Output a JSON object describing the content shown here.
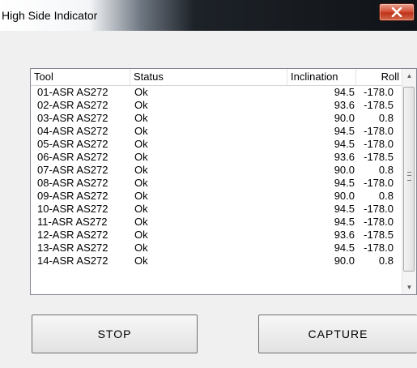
{
  "window": {
    "title": "High Side Indicator"
  },
  "list": {
    "columns": {
      "tool": "Tool",
      "status": "Status",
      "inclination": "Inclination",
      "roll": "Roll"
    },
    "rows": [
      {
        "tool": "01-ASR AS272",
        "status": "Ok",
        "inclination": "94.5",
        "roll": "-178.0"
      },
      {
        "tool": "02-ASR AS272",
        "status": "Ok",
        "inclination": "93.6",
        "roll": "-178.5"
      },
      {
        "tool": "03-ASR AS272",
        "status": "Ok",
        "inclination": "90.0",
        "roll": "0.8"
      },
      {
        "tool": "04-ASR AS272",
        "status": "Ok",
        "inclination": "94.5",
        "roll": "-178.0"
      },
      {
        "tool": "05-ASR AS272",
        "status": "Ok",
        "inclination": "94.5",
        "roll": "-178.0"
      },
      {
        "tool": "06-ASR AS272",
        "status": "Ok",
        "inclination": "93.6",
        "roll": "-178.5"
      },
      {
        "tool": "07-ASR AS272",
        "status": "Ok",
        "inclination": "90.0",
        "roll": "0.8"
      },
      {
        "tool": "08-ASR AS272",
        "status": "Ok",
        "inclination": "94.5",
        "roll": "-178.0"
      },
      {
        "tool": "09-ASR AS272",
        "status": "Ok",
        "inclination": "90.0",
        "roll": "0.8"
      },
      {
        "tool": "10-ASR AS272",
        "status": "Ok",
        "inclination": "94.5",
        "roll": "-178.0"
      },
      {
        "tool": "11-ASR AS272",
        "status": "Ok",
        "inclination": "94.5",
        "roll": "-178.0"
      },
      {
        "tool": "12-ASR AS272",
        "status": "Ok",
        "inclination": "93.6",
        "roll": "-178.5"
      },
      {
        "tool": "13-ASR AS272",
        "status": "Ok",
        "inclination": "94.5",
        "roll": "-178.0"
      },
      {
        "tool": "14-ASR AS272",
        "status": "Ok",
        "inclination": "90.0",
        "roll": "0.8"
      }
    ]
  },
  "buttons": {
    "stop": "STOP",
    "capture": "CAPTURE"
  },
  "icons": {
    "close": "close-icon",
    "scroll_up": "arrow-up-icon",
    "scroll_down": "arrow-down-icon"
  },
  "colors": {
    "close_button": "#c7432a",
    "titlebar_dark": "#101317"
  }
}
